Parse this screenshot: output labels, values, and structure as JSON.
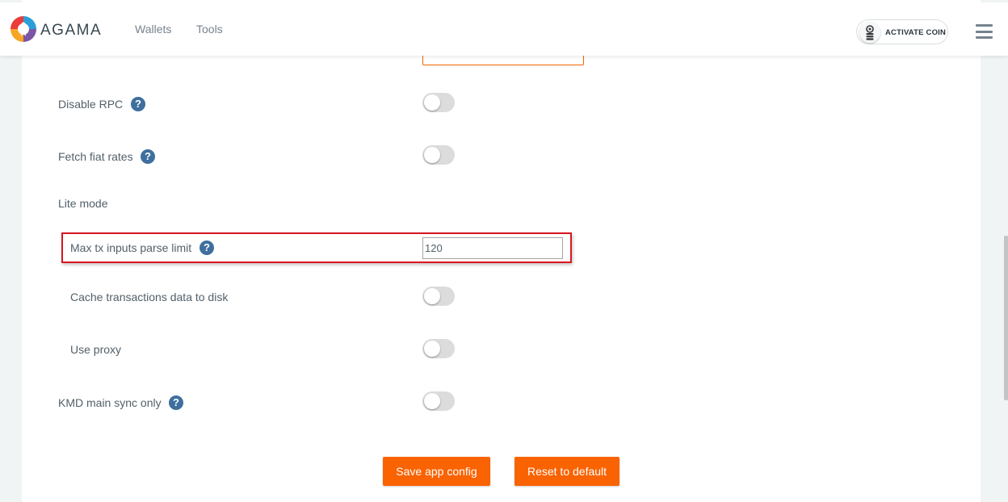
{
  "header": {
    "brand": "AGAMA",
    "nav": [
      "Wallets",
      "Tools"
    ],
    "activate_coin": "ACTIVATE COIN"
  },
  "settings": {
    "disable_rpc": "Disable RPC",
    "fetch_fiat_rates": "Fetch fiat rates",
    "lite_mode": "Lite mode",
    "max_tx_inputs": "Max tx inputs parse limit",
    "max_tx_inputs_value": "120",
    "cache_transactions": "Cache transactions data to disk",
    "use_proxy": "Use proxy",
    "kmd_main_sync": "KMD main sync only",
    "help_glyph": "?"
  },
  "buttons": {
    "save": "Save app config",
    "reset": "Reset to default"
  },
  "colors": {
    "accent": "#f96302",
    "help_icon": "#3e6f9e",
    "highlight": "#d9161f"
  }
}
